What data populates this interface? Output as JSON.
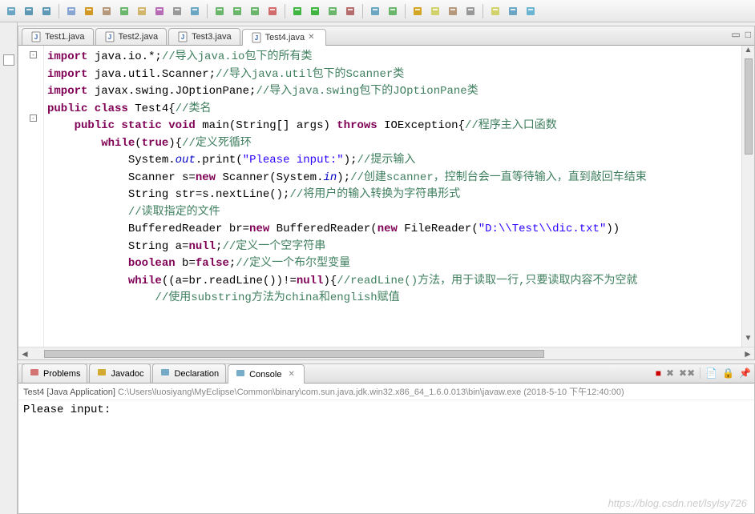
{
  "toolbar": {
    "groups": [
      [
        "new-icon",
        "save-icon",
        "save-all-icon"
      ],
      [
        "wizard-icon",
        "ant-icon",
        "package-icon",
        "open-type-icon",
        "folder-icon",
        "xml-icon",
        "table-icon",
        "search-icon"
      ],
      [
        "debug-ext-icon",
        "run-ext-icon",
        "debug-icon",
        "external-tools-icon"
      ],
      [
        "run-green-icon",
        "debug-green-icon",
        "run-alt-icon",
        "profile-icon"
      ],
      [
        "new-server-icon",
        "new-class-icon"
      ],
      [
        "format-icon",
        "highlight-icon",
        "link-icon",
        "wrench-icon"
      ],
      [
        "back-icon",
        "forward-icon",
        "perspective-icon"
      ]
    ]
  },
  "tabs": [
    {
      "label": "Test1.java",
      "active": false
    },
    {
      "label": "Test2.java",
      "active": false
    },
    {
      "label": "Test3.java",
      "active": false
    },
    {
      "label": "Test4.java",
      "active": true
    }
  ],
  "code": {
    "lines": [
      {
        "indent": 0,
        "tokens": [
          {
            "t": "kw",
            "v": "import"
          },
          {
            "t": "",
            "v": " java.io.*;"
          },
          {
            "t": "com",
            "v": "//导入java.io包下的所有类"
          }
        ]
      },
      {
        "indent": 0,
        "tokens": [
          {
            "t": "kw",
            "v": "import"
          },
          {
            "t": "",
            "v": " java.util.Scanner;"
          },
          {
            "t": "com",
            "v": "//导入java.util包下的Scanner类"
          }
        ]
      },
      {
        "indent": 0,
        "tokens": [
          {
            "t": "kw",
            "v": "import"
          },
          {
            "t": "",
            "v": " javax.swing.JOptionPane;"
          },
          {
            "t": "com",
            "v": "//导入java.swing包下的JOptionPane类"
          }
        ]
      },
      {
        "indent": 0,
        "tokens": [
          {
            "t": "kw",
            "v": "public class"
          },
          {
            "t": "",
            "v": " Test4{"
          },
          {
            "t": "com",
            "v": "//类名"
          }
        ]
      },
      {
        "indent": 1,
        "tokens": [
          {
            "t": "kw",
            "v": "public static void"
          },
          {
            "t": "",
            "v": " main(String[] args) "
          },
          {
            "t": "kw",
            "v": "throws"
          },
          {
            "t": "",
            "v": " IOException{"
          },
          {
            "t": "com",
            "v": "//程序主入口函数"
          }
        ]
      },
      {
        "indent": 2,
        "tokens": [
          {
            "t": "kw",
            "v": "while"
          },
          {
            "t": "",
            "v": "("
          },
          {
            "t": "kw",
            "v": "true"
          },
          {
            "t": "",
            "v": "){"
          },
          {
            "t": "com",
            "v": "//定义死循环"
          }
        ]
      },
      {
        "indent": 3,
        "tokens": [
          {
            "t": "",
            "v": "System."
          },
          {
            "t": "sfield",
            "v": "out"
          },
          {
            "t": "",
            "v": ".print("
          },
          {
            "t": "str",
            "v": "\"Please input:\""
          },
          {
            "t": "",
            "v": ");"
          },
          {
            "t": "com",
            "v": "//提示输入"
          }
        ]
      },
      {
        "indent": 3,
        "tokens": [
          {
            "t": "",
            "v": "Scanner s="
          },
          {
            "t": "kw",
            "v": "new"
          },
          {
            "t": "",
            "v": " Scanner(System."
          },
          {
            "t": "sfield",
            "v": "in"
          },
          {
            "t": "",
            "v": ");"
          },
          {
            "t": "com",
            "v": "//创建scanner，控制台会一直等待输入，直到敲回车结束"
          }
        ]
      },
      {
        "indent": 3,
        "tokens": [
          {
            "t": "",
            "v": "String str=s.nextLine();"
          },
          {
            "t": "com",
            "v": "//将用户的输入转换为字符串形式"
          }
        ]
      },
      {
        "indent": 3,
        "tokens": [
          {
            "t": "com",
            "v": "//读取指定的文件"
          }
        ]
      },
      {
        "indent": 3,
        "tokens": [
          {
            "t": "",
            "v": "BufferedReader br="
          },
          {
            "t": "kw",
            "v": "new"
          },
          {
            "t": "",
            "v": " BufferedReader("
          },
          {
            "t": "kw",
            "v": "new"
          },
          {
            "t": "",
            "v": " FileReader("
          },
          {
            "t": "str",
            "v": "\"D:\\\\Test\\\\dic.txt\""
          },
          {
            "t": "",
            "v": "))"
          }
        ]
      },
      {
        "indent": 3,
        "tokens": [
          {
            "t": "",
            "v": "String a="
          },
          {
            "t": "kw",
            "v": "null"
          },
          {
            "t": "",
            "v": ";"
          },
          {
            "t": "com",
            "v": "//定义一个空字符串"
          }
        ]
      },
      {
        "indent": 3,
        "tokens": [
          {
            "t": "kw",
            "v": "boolean"
          },
          {
            "t": "",
            "v": " b="
          },
          {
            "t": "kw",
            "v": "false"
          },
          {
            "t": "",
            "v": ";"
          },
          {
            "t": "com",
            "v": "//定义一个布尔型变量"
          }
        ]
      },
      {
        "indent": 3,
        "tokens": [
          {
            "t": "kw",
            "v": "while"
          },
          {
            "t": "",
            "v": "((a=br.readLine())!="
          },
          {
            "t": "kw",
            "v": "null"
          },
          {
            "t": "",
            "v": "){"
          },
          {
            "t": "com",
            "v": "//readLine()方法，用于读取一行,只要读取内容不为空就"
          }
        ]
      },
      {
        "indent": 4,
        "tokens": [
          {
            "t": "com",
            "v": "//使用substring方法为china和english赋值"
          }
        ]
      }
    ]
  },
  "bottom": {
    "tabs": [
      {
        "label": "Problems",
        "icon": "problems-icon",
        "active": false
      },
      {
        "label": "Javadoc",
        "icon": "javadoc-icon",
        "active": false
      },
      {
        "label": "Declaration",
        "icon": "declaration-icon",
        "active": false
      },
      {
        "label": "Console",
        "icon": "console-icon",
        "active": true
      }
    ],
    "info_prefix": "Test4 [Java Application] ",
    "info_path": "C:\\Users\\luosiyang\\MyEclipse\\Common\\binary\\com.sun.java.jdk.win32.x86_64_1.6.0.013\\bin\\javaw.exe (2018-5-10 下午12:40:00)",
    "output": "Please input:"
  },
  "watermark": "https://blog.csdn.net/lsylsy726"
}
